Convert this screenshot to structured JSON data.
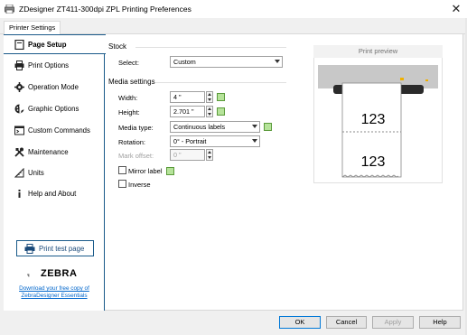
{
  "window": {
    "title": "ZDesigner ZT411-300dpi ZPL Printing Preferences",
    "close_glyph": "✕"
  },
  "tabs": [
    {
      "label": "Printer Settings"
    }
  ],
  "sidebar": {
    "items": [
      {
        "label": "Page Setup",
        "icon": "page-setup-icon",
        "active": true
      },
      {
        "label": "Print Options",
        "icon": "printer-icon"
      },
      {
        "label": "Operation Mode",
        "icon": "gear-icon"
      },
      {
        "label": "Graphic Options",
        "icon": "palette-icon"
      },
      {
        "label": "Custom Commands",
        "icon": "commands-icon"
      },
      {
        "label": "Maintenance",
        "icon": "tools-icon"
      },
      {
        "label": "Units",
        "icon": "ruler-icon"
      },
      {
        "label": "Help and About",
        "icon": "info-icon"
      }
    ],
    "print_test_label": "Print test page",
    "brand": "ZEBRA",
    "download_link": "Download your free copy of ZebraDesigner Essentials"
  },
  "stock": {
    "section": "Stock",
    "select_label": "Select:",
    "select_value": "Custom"
  },
  "media": {
    "section": "Media settings",
    "width_label": "Width:",
    "width_value": "4 \"",
    "height_label": "Height:",
    "height_value": "2.701 \"",
    "media_type_label": "Media type:",
    "media_type_value": "Continuous labels",
    "rotation_label": "Rotation:",
    "rotation_value": "0° - Portrait",
    "mark_offset_label": "Mark offset:",
    "mark_offset_value": "0 \"",
    "mirror_label": "Mirror label",
    "mirror_checked": false,
    "inverse_label": "Inverse",
    "inverse_checked": false
  },
  "preview": {
    "header": "Print preview",
    "label_text_1": "123",
    "label_text_2": "123"
  },
  "buttons": {
    "ok": "OK",
    "cancel": "Cancel",
    "apply": "Apply",
    "help": "Help"
  },
  "colors": {
    "accent": "#1a5a8a",
    "lock_green": "#b6e39a",
    "printer_body": "#c8c8c8",
    "printer_light": "#f0b000"
  }
}
